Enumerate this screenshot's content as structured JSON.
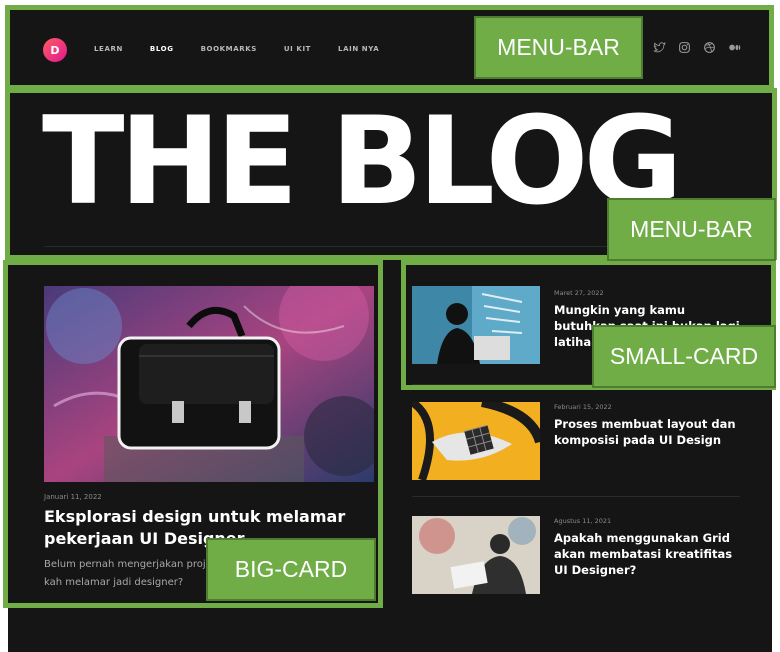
{
  "logo": {
    "letter": "D"
  },
  "nav": {
    "items": [
      "LEARN",
      "BLOG",
      "BOOKMARKS",
      "UI KIT",
      "LAIN NYA"
    ],
    "active": "BLOG"
  },
  "socials": [
    "twitter-icon",
    "instagram-icon",
    "dribbble-icon",
    "medium-icon"
  ],
  "hero": {
    "title": "THE BLOG"
  },
  "big_card": {
    "date": "Januari 11, 2022",
    "title": "Eksplorasi design untuk melamar pekerjaan UI Designer",
    "desc": "Belum pernah mengerjakan project eksplorasi design, bisa kah melamar jadi designer?"
  },
  "small_cards": [
    {
      "date": "Maret 27, 2022",
      "title": "Mungkin yang kamu butuhkan saat ini bukan lagi latihan"
    },
    {
      "date": "Februari 15, 2022",
      "title": "Proses membuat layout dan komposisi pada UI Design"
    },
    {
      "date": "Agustus 11, 2021",
      "title": "Apakah menggunakan Grid akan membatasi kreatifitas UI Designer?"
    }
  ],
  "annotations": [
    "MENU-BAR",
    "MENU-BAR",
    "SMALL-CARD",
    "BIG-CARD"
  ],
  "colors": {
    "background": "#151515",
    "annotation": "#70ad47",
    "logo": "#e0168f"
  }
}
